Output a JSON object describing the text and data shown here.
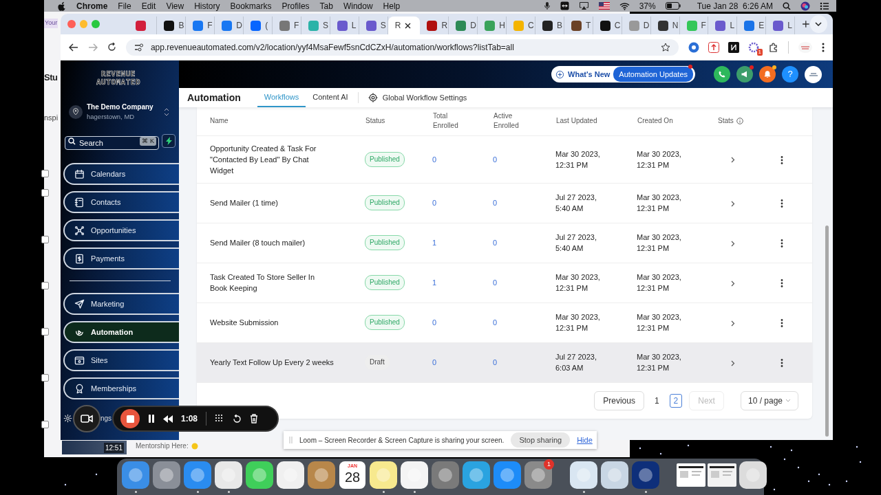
{
  "menu_bar": {
    "app": "Chrome",
    "menus": [
      "File",
      "Edit",
      "View",
      "History",
      "Bookmarks",
      "Profiles",
      "Tab",
      "Window",
      "Help"
    ],
    "battery": "37%",
    "clock": "Tue Jan 28  6:26 AM"
  },
  "background_window": {
    "tab_fragment": "Your",
    "heading_fragment": "Stu",
    "text_fragment": "nspi",
    "thumbnail_time": "12:51",
    "message": "Mentorship Here:",
    "checkboxes": [
      {
        "checked": false
      },
      {
        "checked": false
      },
      {
        "checked": false
      },
      {
        "checked": false
      },
      {
        "checked": false
      },
      {
        "checked": false
      },
      {
        "checked": false
      }
    ]
  },
  "browser_tabs": [
    {
      "color": "#d21f3c",
      "selected": false
    },
    {
      "letter": "B",
      "color": "#111111",
      "selected": false
    },
    {
      "letter": "F",
      "color": "#1877f2",
      "selected": false
    },
    {
      "letter": "D",
      "color": "#1877f2",
      "selected": false
    },
    {
      "letter": "(",
      "color": "#0866ff",
      "selected": false
    },
    {
      "letter": "F",
      "color": "#777777",
      "selected": false
    },
    {
      "letter": "S",
      "color": "#2bb3a8",
      "selected": false
    },
    {
      "letter": "L",
      "color": "#6a5acd",
      "selected": false
    },
    {
      "letter": "S",
      "color": "#6a5acd",
      "selected": false
    },
    {
      "letter": "R",
      "selected": true
    },
    {
      "letter": "R",
      "color": "#b01010",
      "selected": false
    },
    {
      "letter": "D",
      "color": "#2e8b57",
      "selected": false
    },
    {
      "letter": "H",
      "color": "#3aa35b",
      "selected": false
    },
    {
      "letter": "C",
      "color": "#f4b400",
      "selected": false
    },
    {
      "letter": "B",
      "color": "#222222",
      "selected": false
    },
    {
      "letter": "T",
      "color": "#6b4226",
      "selected": false
    },
    {
      "letter": "C",
      "color": "#111111",
      "selected": false
    },
    {
      "letter": "D",
      "color": "#999999",
      "selected": false
    },
    {
      "letter": "N",
      "color": "#333333",
      "selected": false
    },
    {
      "letter": "F",
      "color": "#34c759",
      "selected": false
    },
    {
      "letter": "L",
      "color": "#6a5acd",
      "selected": false
    },
    {
      "letter": "E",
      "color": "#1a73e8",
      "selected": false
    },
    {
      "letter": "L",
      "color": "#6a5acd",
      "selected": false
    }
  ],
  "address_bar": {
    "url": "app.revenueautomated.com/v2/location/yyf4MsaFewf5snCdCZxH/automation/workflows?listTab=all",
    "extension_badge": "1"
  },
  "sidebar": {
    "logo": [
      "REVENUE",
      "AUTOMATED"
    ],
    "company": "The Demo Company",
    "location": "hagerstown, MD",
    "search": {
      "placeholder": "Search",
      "shortcut": "⌘ K"
    },
    "groups": [
      [
        {
          "label": "Calendars",
          "selected": false
        },
        {
          "label": "Contacts",
          "selected": false
        },
        {
          "label": "Opportunities",
          "selected": false
        },
        {
          "label": "Payments",
          "selected": false
        }
      ],
      [
        {
          "label": "Marketing",
          "selected": false
        },
        {
          "label": "Automation",
          "selected": true
        },
        {
          "label": "Sites",
          "selected": false
        },
        {
          "label": "Memberships",
          "selected": false
        }
      ]
    ],
    "settings_fragment": "ngs"
  },
  "header": {
    "whats_new": "What's New",
    "updates": "Automation Updates",
    "help": "?"
  },
  "subheader": {
    "title": "Automation",
    "tabs": [
      {
        "label": "Workflows",
        "selected": true
      },
      {
        "label": "Content AI",
        "selected": false
      }
    ],
    "settings_link": "Global Workflow Settings"
  },
  "table": {
    "columns": [
      "Name",
      "Status",
      "Total Enrolled",
      "Active Enrolled",
      "Last Updated",
      "Created On",
      "Stats"
    ],
    "rows": [
      {
        "name": "Opportunity Created  & Task For \"Contacted By Lead\" By Chat Widget",
        "status": {
          "label": "Published",
          "kind": "published"
        },
        "total": "0",
        "active": "0",
        "last_updated": "Mar 30 2023, 12:31 PM",
        "created_on": "Mar 30 2023, 12:31 PM",
        "hovered": false
      },
      {
        "name": "Send Mailer (1 time)",
        "status": {
          "label": "Published",
          "kind": "published"
        },
        "total": "0",
        "active": "0",
        "last_updated": "Jul 27 2023, 5:40 AM",
        "created_on": "Mar 30 2023, 12:31 PM",
        "hovered": false
      },
      {
        "name": "Send Mailer (8 touch mailer)",
        "status": {
          "label": "Published",
          "kind": "published"
        },
        "total": "1",
        "active": "0",
        "last_updated": "Jul 27 2023, 5:40 AM",
        "created_on": "Mar 30 2023, 12:31 PM",
        "hovered": false
      },
      {
        "name": "Task Created To Store Seller In Book Keeping",
        "status": {
          "label": "Published",
          "kind": "published"
        },
        "total": "1",
        "active": "0",
        "last_updated": "Mar 30 2023, 12:31 PM",
        "created_on": "Mar 30 2023, 12:31 PM",
        "hovered": false
      },
      {
        "name": "Website Submission",
        "status": {
          "label": "Published",
          "kind": "published"
        },
        "total": "0",
        "active": "0",
        "last_updated": "Mar 30 2023, 12:31 PM",
        "created_on": "Mar 30 2023, 12:31 PM",
        "hovered": false
      },
      {
        "name": "Yearly Text Follow Up Every 2 weeks",
        "status": {
          "label": "Draft",
          "kind": "draft"
        },
        "total": "0",
        "active": "0",
        "last_updated": "Jul 27 2023, 6:03 AM",
        "created_on": "Mar 30 2023, 12:31 PM",
        "hovered": true
      }
    ]
  },
  "pagination": {
    "previous": "Previous",
    "pages": [
      {
        "label": "1",
        "selected": false
      },
      {
        "label": "2",
        "selected": true
      }
    ],
    "next": {
      "label": "Next",
      "disabled": true
    },
    "page_size": "10 / page"
  },
  "loom": {
    "timer": "1:08",
    "notice": "Loom – Screen Recorder & Screen Capture is sharing your screen.",
    "stop": "Stop sharing",
    "hide": "Hide"
  },
  "dock": {
    "groups": [
      [
        {
          "kind": "app",
          "color": "#3a8ee6",
          "running": true
        },
        {
          "kind": "app",
          "color": "#8a8f98",
          "running": false
        },
        {
          "kind": "app",
          "color": "#2a8cf0",
          "running": true
        },
        {
          "kind": "app",
          "color": "#e8e8e8",
          "running": true
        },
        {
          "kind": "app",
          "color": "#3fcf5a",
          "running": false
        },
        {
          "kind": "app",
          "color": "#f0f0f0",
          "running": false
        },
        {
          "kind": "app",
          "color": "#b8874a",
          "running": false
        },
        {
          "kind": "calendar",
          "month": "JAN",
          "day": "28",
          "running": false
        },
        {
          "kind": "app",
          "color": "#f7e98e",
          "running": true
        },
        {
          "kind": "app",
          "color": "#f4f4f4",
          "running": true
        },
        {
          "kind": "app",
          "color": "#7a7a7a",
          "running": false
        },
        {
          "kind": "app",
          "color": "#2aa3e0",
          "running": false
        },
        {
          "kind": "app",
          "color": "#1d8cf8",
          "running": false
        },
        {
          "kind": "app",
          "color": "#8a8a8a",
          "running": false,
          "badge": "1"
        }
      ],
      [
        {
          "kind": "app",
          "color": "#d9e6f2",
          "running": true
        },
        {
          "kind": "app",
          "color": "#c8d6e4",
          "running": false
        },
        {
          "kind": "app",
          "color": "#0e2f7a",
          "running": true
        }
      ],
      [
        {
          "kind": "window",
          "color": "#ffffff",
          "running": false
        },
        {
          "kind": "window",
          "color": "#f2f2f2",
          "running": false
        },
        {
          "kind": "app",
          "color": "#dcdcdc",
          "running": false
        }
      ]
    ]
  }
}
